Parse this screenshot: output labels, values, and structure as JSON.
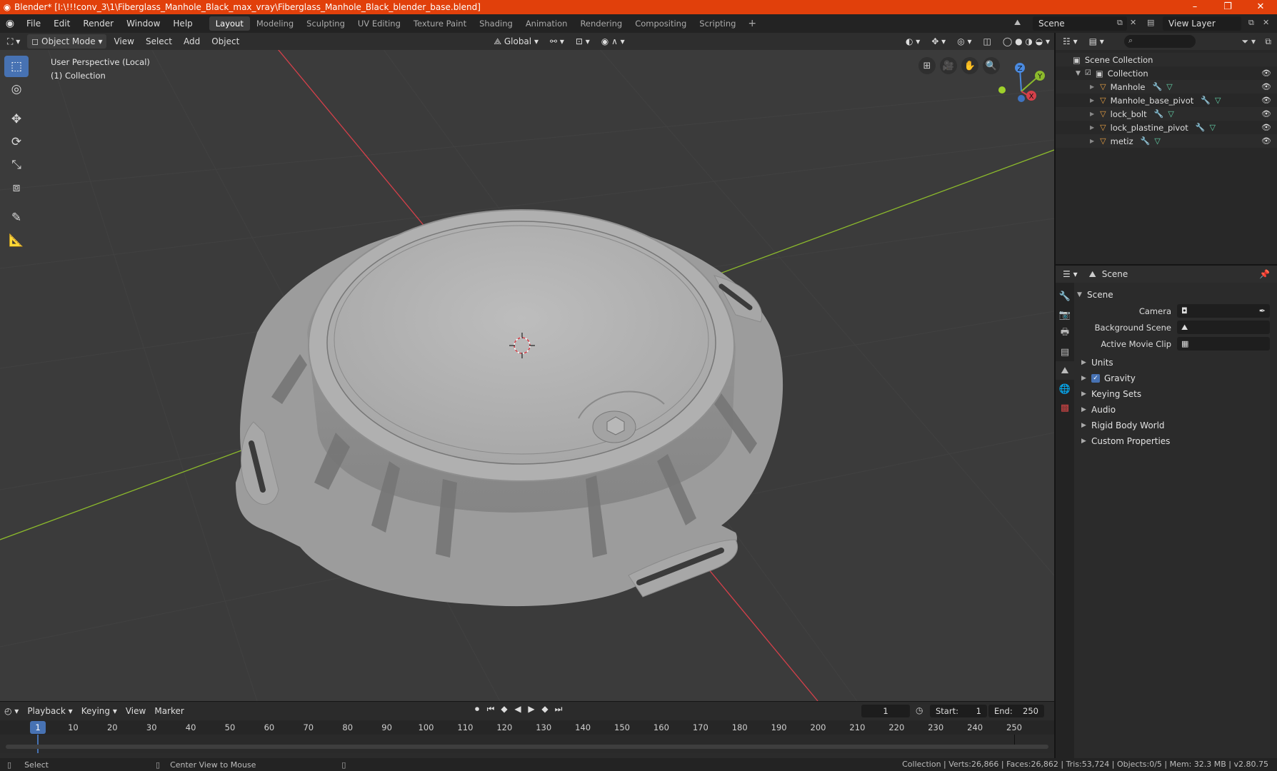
{
  "window": {
    "title": "Blender* [I:\\!!!conv_3\\1\\Fiberglass_Manhole_Black_max_vray\\Fiberglass_Manhole_Black_blender_base.blend]",
    "controls": [
      "–",
      "❐",
      "✕"
    ]
  },
  "menu": {
    "items": [
      "File",
      "Edit",
      "Render",
      "Window",
      "Help"
    ],
    "workspaces": [
      "Layout",
      "Modeling",
      "Sculpting",
      "UV Editing",
      "Texture Paint",
      "Shading",
      "Animation",
      "Rendering",
      "Compositing",
      "Scripting"
    ],
    "active_workspace": "Layout",
    "scene": "Scene",
    "view_layer": "View Layer"
  },
  "viewport": {
    "mode": "Object Mode",
    "menus": [
      "View",
      "Select",
      "Add",
      "Object"
    ],
    "transform_orientation": "Global",
    "perspective_label": "User Perspective (Local)",
    "collection_label": "(1) Collection",
    "gizmo": {
      "x": "X",
      "y": "Y",
      "z": "Z"
    }
  },
  "timeline": {
    "menus": [
      "Playback",
      "Keying",
      "View",
      "Marker"
    ],
    "current_frame": "1",
    "start_label": "Start:",
    "start": "1",
    "end_label": "End:",
    "end": "250",
    "ticks": [
      "1",
      "10",
      "20",
      "30",
      "40",
      "50",
      "60",
      "70",
      "80",
      "90",
      "100",
      "110",
      "120",
      "130",
      "140",
      "150",
      "160",
      "170",
      "180",
      "190",
      "200",
      "210",
      "220",
      "230",
      "240",
      "250"
    ]
  },
  "statusbar": {
    "left_action": "Select",
    "middle_action": "Center View to Mouse",
    "stats": "Collection | Verts:26,866 | Faces:26,862 | Tris:53,724 | Objects:0/5 | Mem: 32.3 MB | v2.80.75"
  },
  "outliner": {
    "root": "Scene Collection",
    "collection": "Collection",
    "objects": [
      "Manhole",
      "Manhole_base_pivot",
      "lock_bolt",
      "lock_plastine_pivot",
      "metiz"
    ]
  },
  "properties": {
    "header": "Scene",
    "panel": "Scene",
    "fields": [
      {
        "label": "Camera",
        "value": ""
      },
      {
        "label": "Background Scene",
        "value": ""
      },
      {
        "label": "Active Movie Clip",
        "value": ""
      }
    ],
    "subpanels": [
      "Units",
      "Gravity",
      "Keying Sets",
      "Audio",
      "Rigid Body World",
      "Custom Properties"
    ]
  },
  "colors": {
    "accent": "#4772b3",
    "title_bar": "#e1400b",
    "viewport_bg": "#3b3b3b",
    "axis_x": "#d6404a",
    "axis_y": "#8cba2c",
    "object_orange": "#e8a043"
  }
}
